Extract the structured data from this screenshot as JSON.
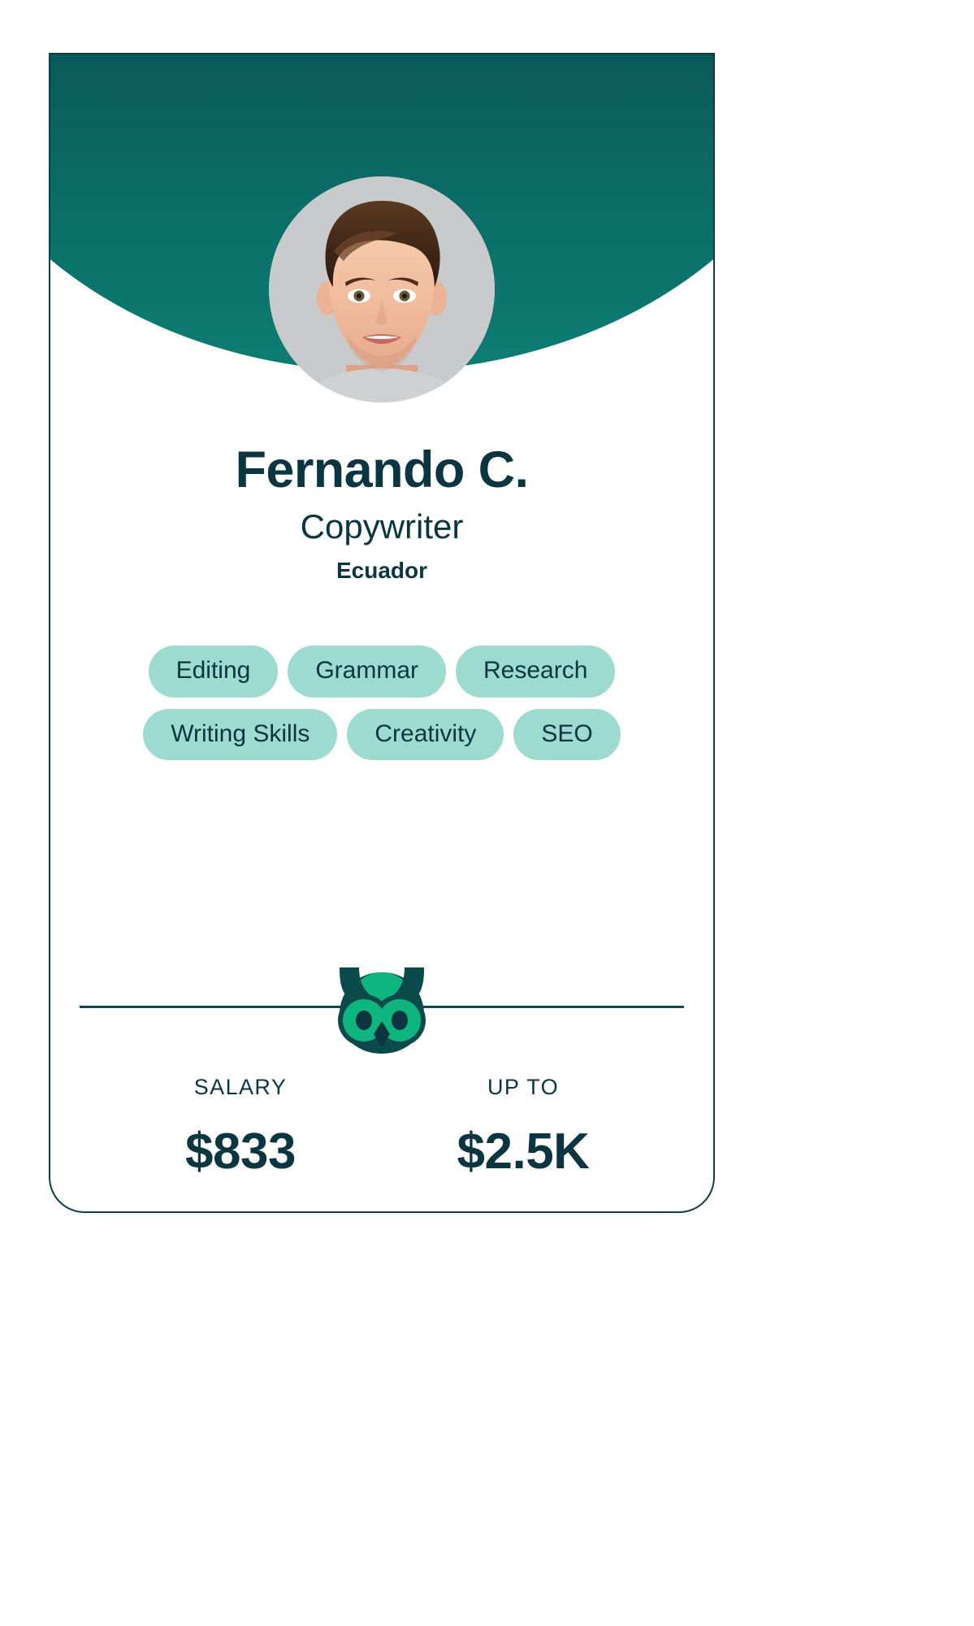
{
  "card": {
    "border_color": "#0b3d45",
    "header_gradient_from": "#0a3b44",
    "header_gradient_to": "#0c7d73"
  },
  "avatar": {
    "alt": "profile-photo-fernando-c",
    "background_color": "#c9cacb"
  },
  "identity": {
    "name": "Fernando C.",
    "role": "Copywriter",
    "country": "Ecuador",
    "text_color": "#0b3540"
  },
  "skills": {
    "pill_bg": "#9ddbd1",
    "pill_text_color": "#0b3540",
    "items": [
      {
        "label": "Editing"
      },
      {
        "label": "Grammar"
      },
      {
        "label": "Research"
      },
      {
        "label": "Writing Skills"
      },
      {
        "label": "Creativity"
      },
      {
        "label": "SEO"
      }
    ]
  },
  "divider": {
    "line_color": "#0b4a52",
    "logo_name": "owl-logo",
    "logo_green": "#0fb57e",
    "logo_dark": "#0b4a4a",
    "logo_pupil": "#0b3540"
  },
  "stats": [
    {
      "label": "SALARY",
      "value": "$833"
    },
    {
      "label": "UP TO",
      "value": "$2.5K"
    }
  ]
}
